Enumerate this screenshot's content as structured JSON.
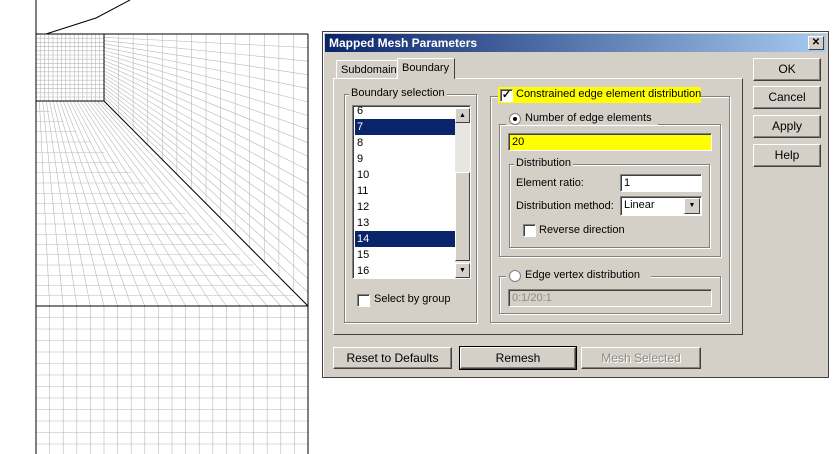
{
  "dialog": {
    "title": "Mapped Mesh Parameters",
    "close_glyph": "✕",
    "tabs": [
      {
        "label": "Subdomain",
        "active": false
      },
      {
        "label": "Boundary",
        "active": true
      }
    ],
    "boundary_selection": {
      "label": "Boundary selection",
      "items": [
        "6",
        "7",
        "8",
        "9",
        "10",
        "11",
        "12",
        "13",
        "14",
        "15",
        "16"
      ],
      "selected": [
        "7",
        "14"
      ]
    },
    "select_by_group": {
      "label": "Select by group",
      "checked": false
    },
    "constrained": {
      "label": "Constrained edge element distribution",
      "checked": true,
      "check_glyph": "✓"
    },
    "number_of_edge_elements": {
      "label": "Number of edge elements",
      "selected": true,
      "value": "20"
    },
    "distribution": {
      "label": "Distribution",
      "element_ratio_label": "Element ratio:",
      "element_ratio_value": "1",
      "method_label": "Distribution method:",
      "method_value": "Linear",
      "reverse_label": "Reverse direction",
      "reverse_checked": false
    },
    "edge_vertex": {
      "label": "Edge vertex distribution",
      "selected": false,
      "value": "0:1/20:1"
    },
    "buttons": {
      "ok": "OK",
      "cancel": "Cancel",
      "apply": "Apply",
      "help": "Help"
    },
    "bottom": {
      "reset": "Reset to Defaults",
      "remesh": "Remesh",
      "mesh_selected": "Mesh Selected"
    },
    "colors": {
      "title_bar": "#0a246a",
      "highlight": "#ffff00",
      "selection": "#0a246a",
      "face": "#d4d0c8"
    }
  }
}
